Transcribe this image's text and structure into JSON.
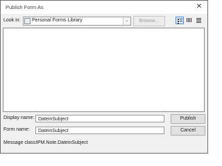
{
  "window": {
    "title": "Publish Form As",
    "close_glyph": "✕"
  },
  "look_in": {
    "label": "Look in:",
    "value": "Personal Forms Library",
    "dropdown_glyph": "⌄",
    "browse_label": "Browse..."
  },
  "view_buttons": [
    {
      "icon": "details-view-icon",
      "active": true
    },
    {
      "icon": "list-view-icon",
      "active": false
    },
    {
      "icon": "thumbnail-view-icon",
      "active": false
    }
  ],
  "display_name": {
    "label": "Display name:",
    "value": "DateinSubject"
  },
  "form_name": {
    "label": "Form name:",
    "value": "DateinSubject"
  },
  "message_class": {
    "label": "Message class:",
    "value": "IPM.Note.DateinSubject"
  },
  "buttons": {
    "publish": "Publish",
    "cancel": "Cancel"
  },
  "colors": {
    "accent": "#4a90d9",
    "dialog_bg": "#f0f0f0"
  }
}
